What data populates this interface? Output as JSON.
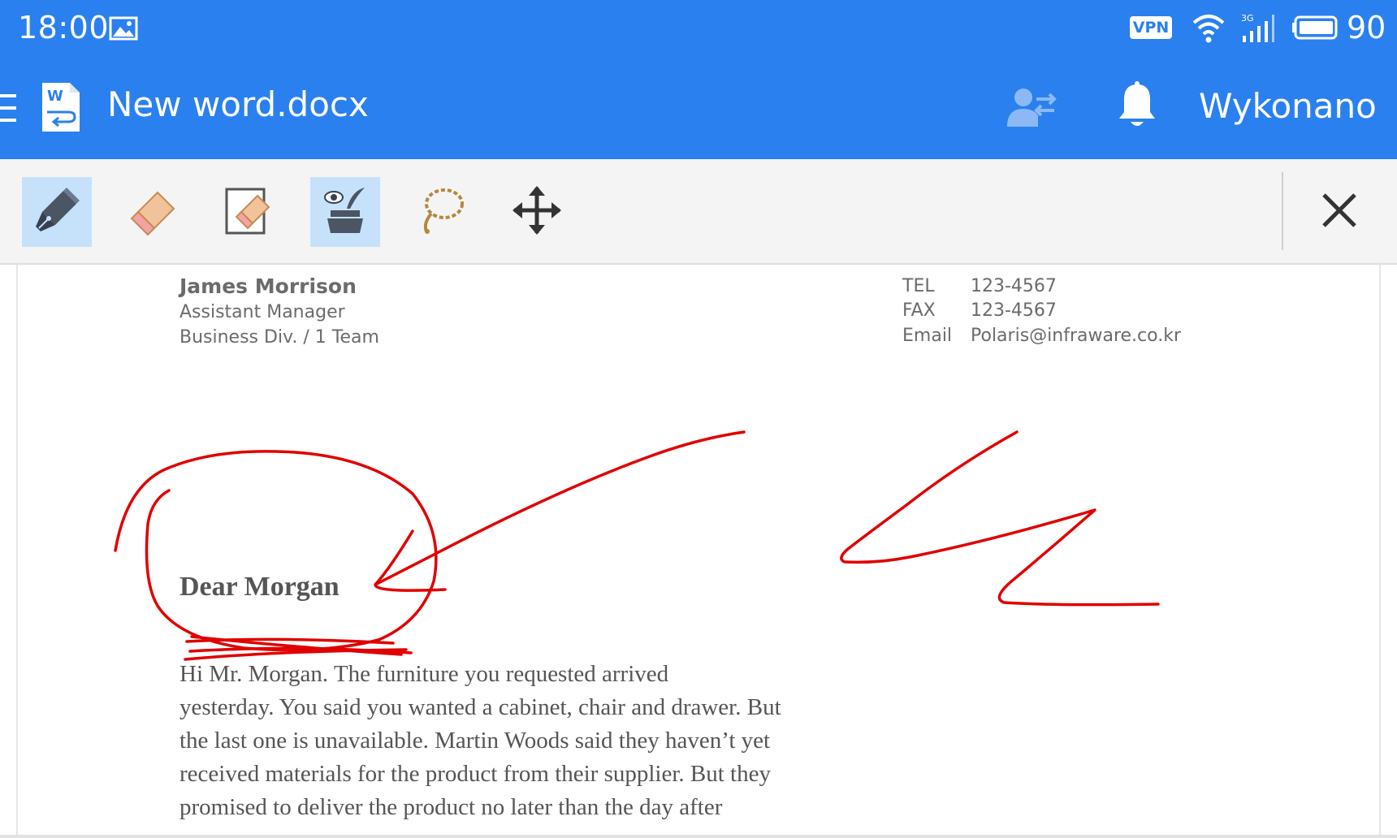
{
  "status_bar": {
    "time": "18:00",
    "vpn_label": "VPN",
    "network_label": "3G",
    "battery_level": "90"
  },
  "app_bar": {
    "title": "New word.docx",
    "done_label": "Wykonano"
  },
  "toolbar": {
    "tools": [
      {
        "name": "pen",
        "active": true
      },
      {
        "name": "eraser",
        "active": false
      },
      {
        "name": "page-eraser",
        "active": false
      },
      {
        "name": "ink-view",
        "active": true
      },
      {
        "name": "lasso",
        "active": false
      },
      {
        "name": "move",
        "active": false
      }
    ]
  },
  "document": {
    "sender": {
      "name": "James Morrison",
      "position": "Assistant Manager",
      "department": "Business Div. / 1 Team"
    },
    "contacts": [
      {
        "label": "TEL",
        "value": "123-4567"
      },
      {
        "label": "FAX",
        "value": "123-4567"
      },
      {
        "label": "Email",
        "value": "Polaris@infraware.co.kr"
      }
    ],
    "greeting": "Dear Morgan",
    "body_struck": "Hi Mr. Morgan.",
    "body_lines": [
      " The furniture you requested arrived",
      "yesterday. You said you wanted a cabinet, chair and drawer. But",
      "the last one is unavailable. Martin Woods said they haven’t yet",
      "received materials for the product from their supplier. But they",
      "promised to deliver the product no later than the day after"
    ]
  },
  "colors": {
    "primary": "#2a80ee",
    "ink": "#e00000",
    "active_tool": "#c6e2fb"
  }
}
